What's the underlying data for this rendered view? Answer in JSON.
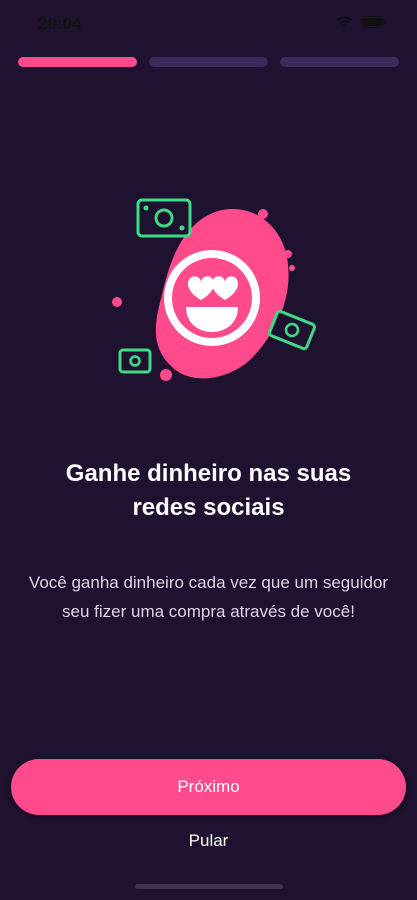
{
  "status_bar": {
    "time": "20:04"
  },
  "progress": {
    "total_steps": 3,
    "current_step": 1
  },
  "illustration": {
    "icon": "heart-eyes-emoji-with-money"
  },
  "content": {
    "title_line1": "Ganhe dinheiro nas suas",
    "title_line2": "redes sociais",
    "description": "Você ganha dinheiro cada vez que um seguidor seu fizer uma compra através de você!"
  },
  "actions": {
    "next_label": "Próximo",
    "skip_label": "Pular"
  },
  "colors": {
    "background": "#1e1230",
    "accent": "#ff4b8b",
    "progress_inactive": "#3a2a5e",
    "money_green": "#3ddc84"
  }
}
